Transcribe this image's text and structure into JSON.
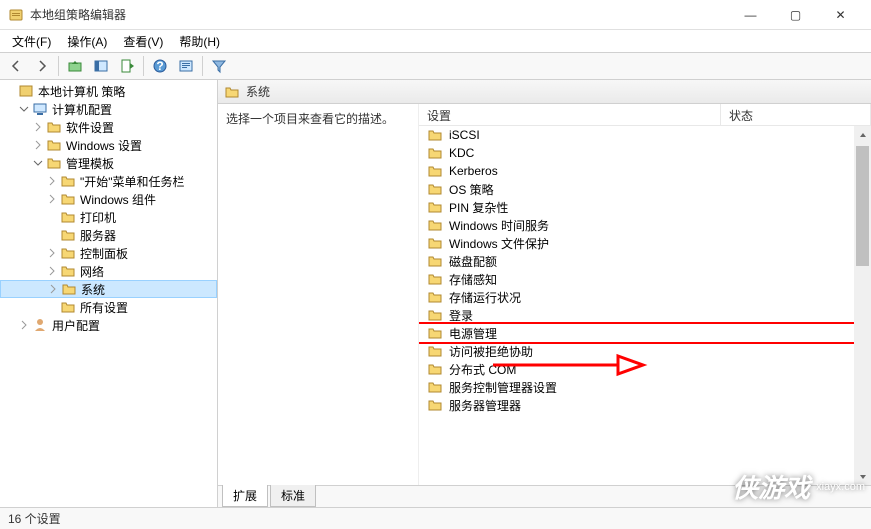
{
  "window": {
    "title": "本地组策略编辑器",
    "minimize": "—",
    "maximize": "▢",
    "close": "✕"
  },
  "menu": {
    "file": "文件(F)",
    "action": "操作(A)",
    "view": "查看(V)",
    "help": "帮助(H)"
  },
  "tree": {
    "root": "本地计算机 策略",
    "computer_config": "计算机配置",
    "software_settings": "软件设置",
    "windows_settings": "Windows 设置",
    "admin_templates": "管理模板",
    "start_menu": "\"开始\"菜单和任务栏",
    "windows_components": "Windows 组件",
    "printers": "打印机",
    "server": "服务器",
    "control_panel": "控制面板",
    "network": "网络",
    "system": "系统",
    "all_settings": "所有设置",
    "user_config": "用户配置"
  },
  "content": {
    "header_title": "系统",
    "description_prompt": "选择一个项目来查看它的描述。",
    "col_setting": "设置",
    "col_state": "状态",
    "items": [
      "iSCSI",
      "KDC",
      "Kerberos",
      "OS 策略",
      "PIN 复杂性",
      "Windows 时间服务",
      "Windows 文件保护",
      "磁盘配额",
      "存储感知",
      "存储运行状况",
      "登录",
      "电源管理",
      "访问被拒绝协助",
      "分布式 COM",
      "服务控制管理器设置",
      "服务器管理器"
    ],
    "highlighted_index": 11
  },
  "tabs": {
    "extended": "扩展",
    "standard": "标准"
  },
  "statusbar": {
    "text": "16 个设置"
  },
  "watermark": {
    "logo": "侠游戏",
    "site": "xiayx.com"
  }
}
